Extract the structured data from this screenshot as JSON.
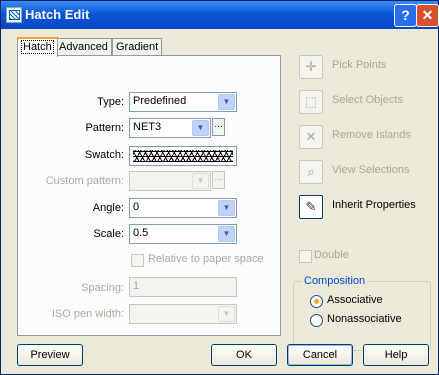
{
  "window": {
    "title": "Hatch Edit",
    "help_label": "?",
    "close_label": "✕"
  },
  "tabs": [
    "Hatch",
    "Advanced",
    "Gradient"
  ],
  "hatch": {
    "type_label": "Type:",
    "type_value": "Predefined",
    "pattern_label": "Pattern:",
    "pattern_value": "NET3",
    "ellipsis": "...",
    "swatch_label": "Swatch:",
    "custom_label": "Custom pattern:",
    "custom_value": "",
    "angle_label": "Angle:",
    "angle_value": "0",
    "scale_label": "Scale:",
    "scale_value": "0.5",
    "relative_label": "Relative to paper space",
    "spacing_label": "Spacing:",
    "spacing_value": "1",
    "iso_label": "ISO pen width:",
    "iso_value": ""
  },
  "side": {
    "pick_points": "Pick Points",
    "select_objects": "Select Objects",
    "remove_islands": "Remove Islands",
    "view_selections": "View Selections",
    "inherit_properties": "Inherit Properties",
    "double": "Double"
  },
  "composition": {
    "title": "Composition",
    "associative": "Associative",
    "nonassociative": "Nonassociative"
  },
  "buttons": {
    "preview": "Preview",
    "ok": "OK",
    "cancel": "Cancel",
    "help": "Help"
  },
  "icons": [
    "pick-points-icon",
    "select-objects-icon",
    "remove-islands-icon",
    "view-selections-icon",
    "inherit-properties-icon"
  ]
}
